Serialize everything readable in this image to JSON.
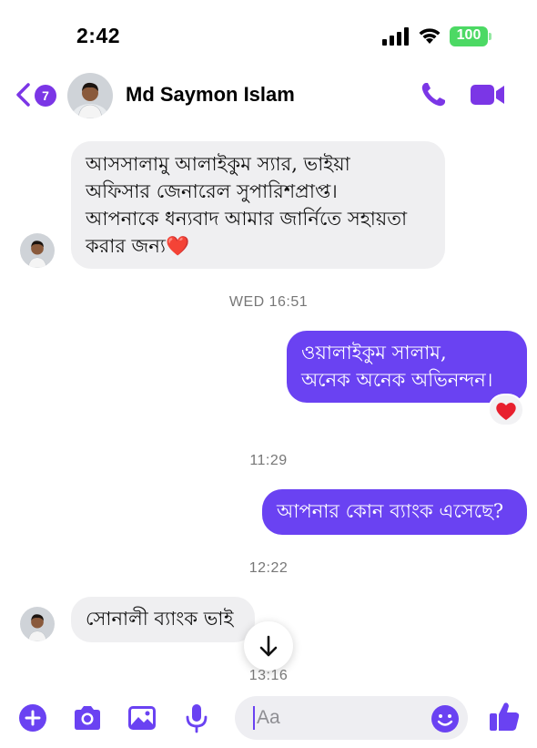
{
  "status_bar": {
    "time": "2:42",
    "battery": "100"
  },
  "header": {
    "back_count": "7",
    "contact_name": "Md Saymon Islam"
  },
  "messages": [
    {
      "side": "in",
      "text": "আসসালামু আলাইকুম স্যার, ভাইয়া\nঅফিসার জেনারেল সুপারিশপ্রাপ্ত।\nআপনাকে ধন্যবাদ আমার জার্নিতে সহায়তা\nকরার জন্য❤️"
    },
    {
      "stamp": "WED 16:51"
    },
    {
      "side": "out",
      "text": "ওয়ালাইকুম সালাম,\nঅনেক অনেক অভিনন্দন।",
      "reaction": "❤️"
    },
    {
      "stamp": "11:29"
    },
    {
      "side": "out",
      "text": "আপনার কোন ব্যাংক এসেছে?"
    },
    {
      "stamp": "12:22"
    },
    {
      "side": "in",
      "text": "সোনালী ব্যাংক ভাই"
    },
    {
      "stamp": "13:16"
    }
  ],
  "composer": {
    "placeholder": "Aa"
  },
  "colors": {
    "accent": "#7b36e6",
    "outgoing_bubble": "#6a42f2",
    "incoming_bubble": "#efeff1"
  },
  "icons": [
    "back-chevron-icon",
    "phone-icon",
    "video-camera-icon",
    "plus-icon",
    "camera-icon",
    "gallery-icon",
    "microphone-icon",
    "emoji-icon",
    "thumbs-up-icon",
    "arrow-down-icon"
  ]
}
